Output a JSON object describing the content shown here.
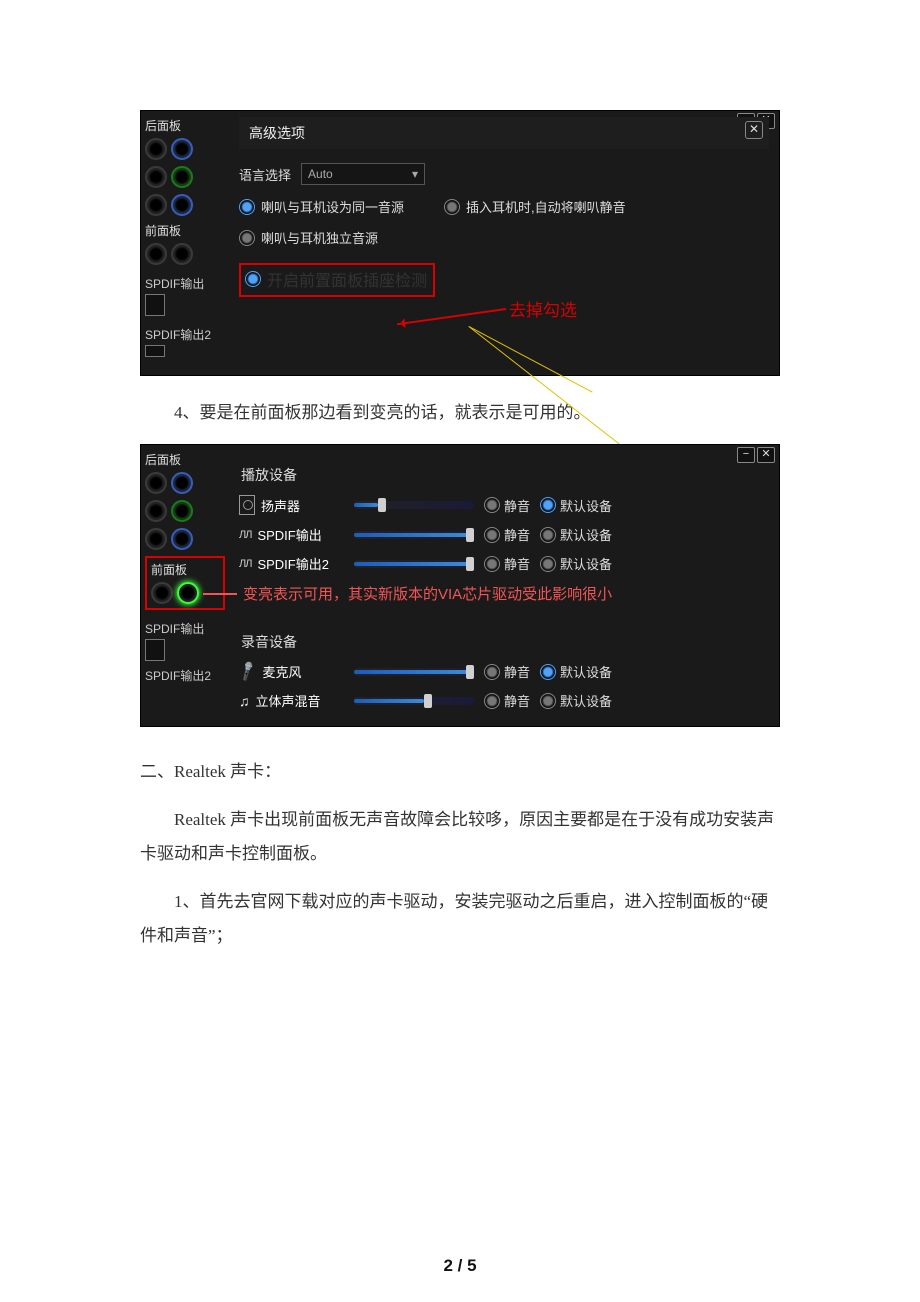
{
  "text": {
    "step4": "4、要是在前面板那边看到变亮的话，就表示是可用的。",
    "heading": "二、Realtek 声卡：",
    "para1": "Realtek 声卡出现前面板无声音故障会比较哆，原因主要都是在于没有成功安装声卡驱动和声卡控制面板。",
    "step1": "1、首先去官网下载对应的声卡驱动，安装完驱动之后重启，进入控制面板的“硬件和声音”；",
    "pageNum": "2 / 5"
  },
  "ss1": {
    "rearPanel": "后面板",
    "frontPanel": "前面板",
    "spdif1": "SPDIF输出",
    "spdif2": "SPDIF输出2",
    "advOptions": "高级选项",
    "langLabel": "语言选择",
    "langValue": "Auto",
    "optSame": "喇叭与耳机设为同一音源",
    "optAutoMute": "插入耳机时,自动将喇叭静音",
    "optIndep": "喇叭与耳机独立音源",
    "optDetect": "开启前置面板插座检测",
    "callout": "去掉勾选"
  },
  "ss2": {
    "rearPanel": "后面板",
    "frontPanel": "前面板",
    "spdif1": "SPDIF输出",
    "spdif2": "SPDIF输出2",
    "playHeader": "播放设备",
    "recHeader": "录音设备",
    "devSpeaker": "扬声器",
    "devSpdif1": "SPDIF输出",
    "devSpdif2": "SPDIF输出2",
    "devMic": "麦克风",
    "devMix": "立体声混音",
    "mute": "静音",
    "default": "默认设备",
    "note": "变亮表示可用，其实新版本的VIA芯片驱动受此影响很小"
  }
}
